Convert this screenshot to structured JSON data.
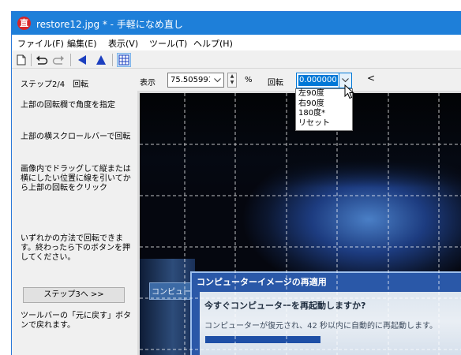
{
  "window": {
    "title": "restore12.jpg * - 手軽になめ直し",
    "app_icon_glyph": "直",
    "titlebar_color": "#1e7fd9"
  },
  "menu": [
    "ファイル(F)",
    "編集(E)",
    "表示(V)",
    "ツール(T)",
    "ヘルプ(H)"
  ],
  "toolbar": {
    "buttons": [
      "new-document-icon",
      "undo-icon",
      "redo-icon",
      "flip-horizontal-icon",
      "flip-vertical-icon",
      "grid-icon"
    ]
  },
  "sidebar": {
    "step_title": "ステップ2/4　回転",
    "instructions": [
      "上部の回転欄で角度を指定",
      "上部の横スクロールバーで回転",
      "画像内でドラッグして縦または横にしたい位置に線を引いてから上部の回転をクリック",
      "いずれかの方法で回転できます。終わったら下のボタンを押してください。"
    ],
    "next_button": "ステップ3へ >>",
    "footer_note": "ツールバーの「元に戻す」ボタンで戻れます。"
  },
  "options": {
    "zoom_label": "表示",
    "zoom_value": "75.505991",
    "zoom_unit": "%",
    "rotate_label": "回転",
    "rotate_value": "0.000000",
    "collapse_glyph": "<"
  },
  "rotate_dropdown": {
    "options": [
      "左90度",
      "右90度",
      "180度*",
      "リセット"
    ]
  },
  "image": {
    "side_label": "コンピュー",
    "dialog_title": "コンピューターイメージの再適用",
    "dialog_question": "今すぐコンピューターを再起動しますか?",
    "dialog_message": "コンピューターが復元され、42 秒以内に自動的に再起動します。",
    "progress": 0.4
  },
  "colors": {
    "accent": "#0078d7",
    "toolbar_blue": "#1c3fbf",
    "grid_line": "#ffffff"
  }
}
